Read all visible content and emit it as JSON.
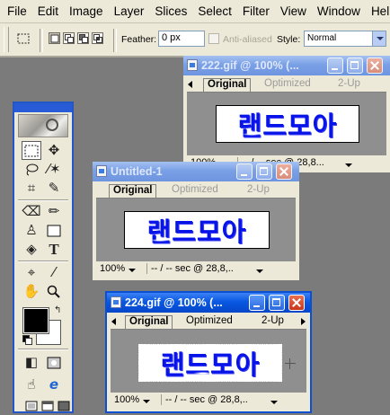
{
  "menu": [
    "File",
    "Edit",
    "Image",
    "Layer",
    "Slices",
    "Select",
    "Filter",
    "View",
    "Window",
    "Help"
  ],
  "options": {
    "feather_label": "Feather:",
    "feather_value": "0 px",
    "antialias_label": "Anti-aliased",
    "style_label": "Style:",
    "style_value": "Normal"
  },
  "tools": [
    "marquee-tool",
    "move-tool",
    "lasso-tool",
    "magic-wand-tool",
    "crop-tool",
    "slice-tool",
    "healing-brush-tool",
    "brush-tool",
    "clone-stamp-tool",
    "history-brush-tool",
    "eraser-tool",
    "gradient-tool",
    "dodge-tool",
    "pen-tool",
    "type-tool",
    "path-selection-tool",
    "shape-tool",
    "notes-tool",
    "eyedropper-tool",
    "hand-tool",
    "zoom-tool"
  ],
  "colors": {
    "foreground": "#000000",
    "background": "#ffffff",
    "title_active": "#0a58e2",
    "sign_text": "#0614e8"
  },
  "windows": {
    "w1": {
      "title": "222.gif @ 100% (...",
      "tabs": [
        "Original",
        "Optimized",
        "2-Up"
      ],
      "image_text": "랜드모아",
      "zoom": "100%",
      "status": "-- / -- sec @ 28,8...",
      "active": false
    },
    "w2": {
      "title": "Untitled-1",
      "tabs": [
        "Original",
        "Optimized",
        "2-Up"
      ],
      "image_text": "랜드모아",
      "zoom": "100%",
      "status": "-- / -- sec @ 28,8,..",
      "active": false
    },
    "w3": {
      "title": "224.gif @ 100% (...",
      "tabs": [
        "Original",
        "Optimized",
        "2-Up"
      ],
      "image_text": "랜드모아",
      "zoom": "100%",
      "status": "-- / -- sec @ 28,8,..",
      "active": true
    }
  }
}
